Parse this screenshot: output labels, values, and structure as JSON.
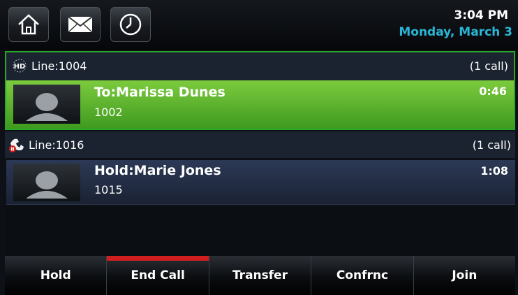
{
  "top_bar": {
    "buttons": [
      {
        "icon": "home-icon"
      },
      {
        "icon": "messages-icon"
      },
      {
        "icon": "clock-icon"
      }
    ],
    "time": "3:04 PM",
    "date": "Monday, March 3",
    "date_color": "#2bb6d6"
  },
  "lines": [
    {
      "label": "Line:1004",
      "count": "(1 call)",
      "icon": "hd-audio-icon",
      "call": {
        "status_name": "To:Marissa Dunes",
        "number": "1002",
        "timer": "0:46",
        "state": "active",
        "color": "#5fb32f"
      }
    },
    {
      "label": "Line:1016",
      "count": "(1 call)",
      "icon": "held-call-icon",
      "call": {
        "status_name": "Hold:Marie Jones",
        "number": "1015",
        "timer": "1:08",
        "state": "hold"
      }
    }
  ],
  "softkeys": [
    {
      "label": "Hold"
    },
    {
      "label": "End Call",
      "highlight_color": "#d11f1f"
    },
    {
      "label": "Transfer"
    },
    {
      "label": "Confrnc"
    },
    {
      "label": "Join"
    }
  ]
}
